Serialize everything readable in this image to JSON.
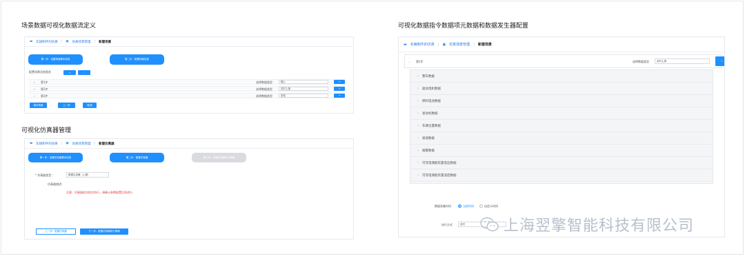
{
  "titles": {
    "left_top": "场景数据可视化数据流定义",
    "left_bottom": "可视化仿真器管理",
    "right": "可视化数据指令数据项元数据和数据发生器配置"
  },
  "shot1": {
    "crumbs": [
      "车辆和件的仿真",
      "仿真场景管理",
      "新建场景"
    ],
    "step1": "第一步：设置场景基本信息",
    "step2": "第二步：配置场景信息",
    "config_label": "配置场景总结相关",
    "add_btn": "+",
    "del_btn": "-",
    "rows": [
      {
        "name": "第1步",
        "label": "选择数据类型",
        "value": "输入"
      },
      {
        "name": "第2步",
        "label": "选择数据类型",
        "value": "实时上报"
      },
      {
        "name": "第3步",
        "label": "选择数据类型",
        "value": "告知"
      }
    ],
    "row_btn": "→",
    "bottom_btns": [
      "保存场景",
      "上一步",
      "取消"
    ]
  },
  "shot2": {
    "crumbs": [
      "车辆和件的仿真",
      "仿真场景管理",
      "新建仿真器"
    ],
    "step1": "第一步：设置仿真器基本信息",
    "step2": "第二步：配置仿真器",
    "step3": "第三步：设置仿真器执行策略",
    "field1_label": "* 仿真器类型：",
    "field1_value": "数据生成器（上报）",
    "field2_label": "仿真器描述：",
    "warning": "注意：仿真器依次依次执行，请确认参数配置后再进行",
    "prev_btn": "上一步：配置仿真器",
    "next_btn": "下一步：配置仿真器执行策略"
  },
  "shot3": {
    "crumbs": [
      "车辆和件的仿真",
      "仿真场景管理",
      "新建场景"
    ],
    "step_label": "第2步",
    "type_label": "选择数据类型",
    "type_value": "实时上报",
    "items": [
      "整车数据",
      "驱动电机数据",
      "燃料电池数据",
      "发动机数据",
      "车辆位置数据",
      "极值数据",
      "报警数据",
      "可充电储能装置电压数据",
      "可充电储能装置温度数据"
    ],
    "collect_label": "数据采集时间",
    "radio_on": "当前时间",
    "radio_off": "自定义时间",
    "exec_label": "执行方式",
    "exec_value": "定时"
  },
  "watermark": "上海翌擎智能科技有限公司",
  "colors": {
    "accent": "#1e90ff",
    "border": "#e4e4e4"
  }
}
